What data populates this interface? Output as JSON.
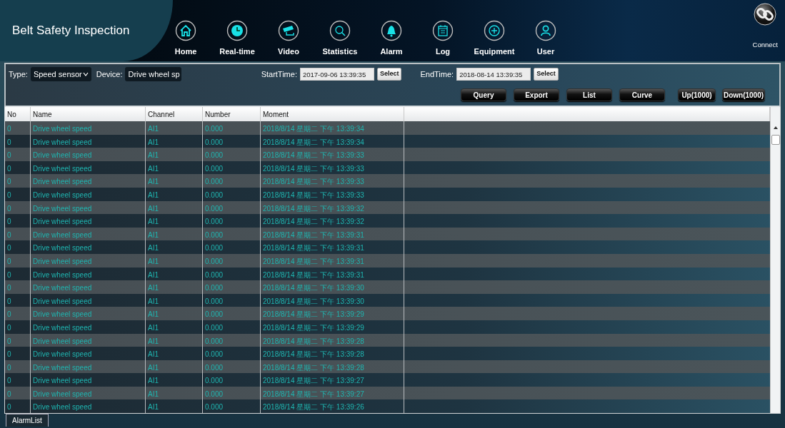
{
  "app_title": "Belt Safety Inspection",
  "nav": [
    {
      "label": "Home",
      "kind": "home"
    },
    {
      "label": "Real-time",
      "kind": "clock"
    },
    {
      "label": "Video",
      "kind": "camera"
    },
    {
      "label": "Statistics",
      "kind": "search"
    },
    {
      "label": "Alarm",
      "kind": "bell"
    },
    {
      "label": "Log",
      "kind": "calendar"
    },
    {
      "label": "Equipment",
      "kind": "plus"
    },
    {
      "label": "User",
      "kind": "user"
    }
  ],
  "connect": {
    "label": "Connect"
  },
  "filters": {
    "type_label": "Type:",
    "type_value": "Speed sensor",
    "device_label": "Device:",
    "device_value": "Drive wheel sp",
    "start_label": "StartTime:",
    "start_value": "2017-09-06 13:39:35",
    "start_button": "Select",
    "end_label": "EndTime:",
    "end_value": "2018-08-14 13:39:35",
    "end_button": "Select"
  },
  "actions": [
    {
      "label": "Query",
      "kind": "main"
    },
    {
      "label": "Export",
      "kind": "main"
    },
    {
      "label": "List",
      "kind": "main"
    },
    {
      "label": "Curve",
      "kind": "main"
    },
    {
      "label": "Up(1000)",
      "kind": "page"
    },
    {
      "label": "Down(1000)",
      "kind": "page"
    }
  ],
  "table": {
    "columns": [
      "No",
      "Name",
      "Channel",
      "Number",
      "Moment"
    ],
    "rows": [
      [
        "0",
        "Drive wheel speed",
        "AI1",
        "0.000",
        "2018/8/14 星期二 下午 13:39:34"
      ],
      [
        "0",
        "Drive wheel speed",
        "AI1",
        "0.000",
        "2018/8/14 星期二 下午 13:39:34"
      ],
      [
        "0",
        "Drive wheel speed",
        "AI1",
        "0.000",
        "2018/8/14 星期二 下午 13:39:33"
      ],
      [
        "0",
        "Drive wheel speed",
        "AI1",
        "0.000",
        "2018/8/14 星期二 下午 13:39:33"
      ],
      [
        "0",
        "Drive wheel speed",
        "AI1",
        "0.000",
        "2018/8/14 星期二 下午 13:39:33"
      ],
      [
        "0",
        "Drive wheel speed",
        "AI1",
        "0.000",
        "2018/8/14 星期二 下午 13:39:33"
      ],
      [
        "0",
        "Drive wheel speed",
        "AI1",
        "0.000",
        "2018/8/14 星期二 下午 13:39:32"
      ],
      [
        "0",
        "Drive wheel speed",
        "AI1",
        "0.000",
        "2018/8/14 星期二 下午 13:39:32"
      ],
      [
        "0",
        "Drive wheel speed",
        "AI1",
        "0.000",
        "2018/8/14 星期二 下午 13:39:31"
      ],
      [
        "0",
        "Drive wheel speed",
        "AI1",
        "0.000",
        "2018/8/14 星期二 下午 13:39:31"
      ],
      [
        "0",
        "Drive wheel speed",
        "AI1",
        "0.000",
        "2018/8/14 星期二 下午 13:39:31"
      ],
      [
        "0",
        "Drive wheel speed",
        "AI1",
        "0.000",
        "2018/8/14 星期二 下午 13:39:31"
      ],
      [
        "0",
        "Drive wheel speed",
        "AI1",
        "0.000",
        "2018/8/14 星期二 下午 13:39:30"
      ],
      [
        "0",
        "Drive wheel speed",
        "AI1",
        "0.000",
        "2018/8/14 星期二 下午 13:39:30"
      ],
      [
        "0",
        "Drive wheel speed",
        "AI1",
        "0.000",
        "2018/8/14 星期二 下午 13:39:29"
      ],
      [
        "0",
        "Drive wheel speed",
        "AI1",
        "0.000",
        "2018/8/14 星期二 下午 13:39:29"
      ],
      [
        "0",
        "Drive wheel speed",
        "AI1",
        "0.000",
        "2018/8/14 星期二 下午 13:39:28"
      ],
      [
        "0",
        "Drive wheel speed",
        "AI1",
        "0.000",
        "2018/8/14 星期二 下午 13:39:28"
      ],
      [
        "0",
        "Drive wheel speed",
        "AI1",
        "0.000",
        "2018/8/14 星期二 下午 13:39:28"
      ],
      [
        "0",
        "Drive wheel speed",
        "AI1",
        "0.000",
        "2018/8/14 星期二 下午 13:39:27"
      ],
      [
        "0",
        "Drive wheel speed",
        "AI1",
        "0.000",
        "2018/8/14 星期二 下午 13:39:27"
      ],
      [
        "0",
        "Drive wheel speed",
        "AI1",
        "0.000",
        "2018/8/14 星期二 下午 13:39:26"
      ]
    ]
  },
  "bottom_tab": "AlarmList"
}
